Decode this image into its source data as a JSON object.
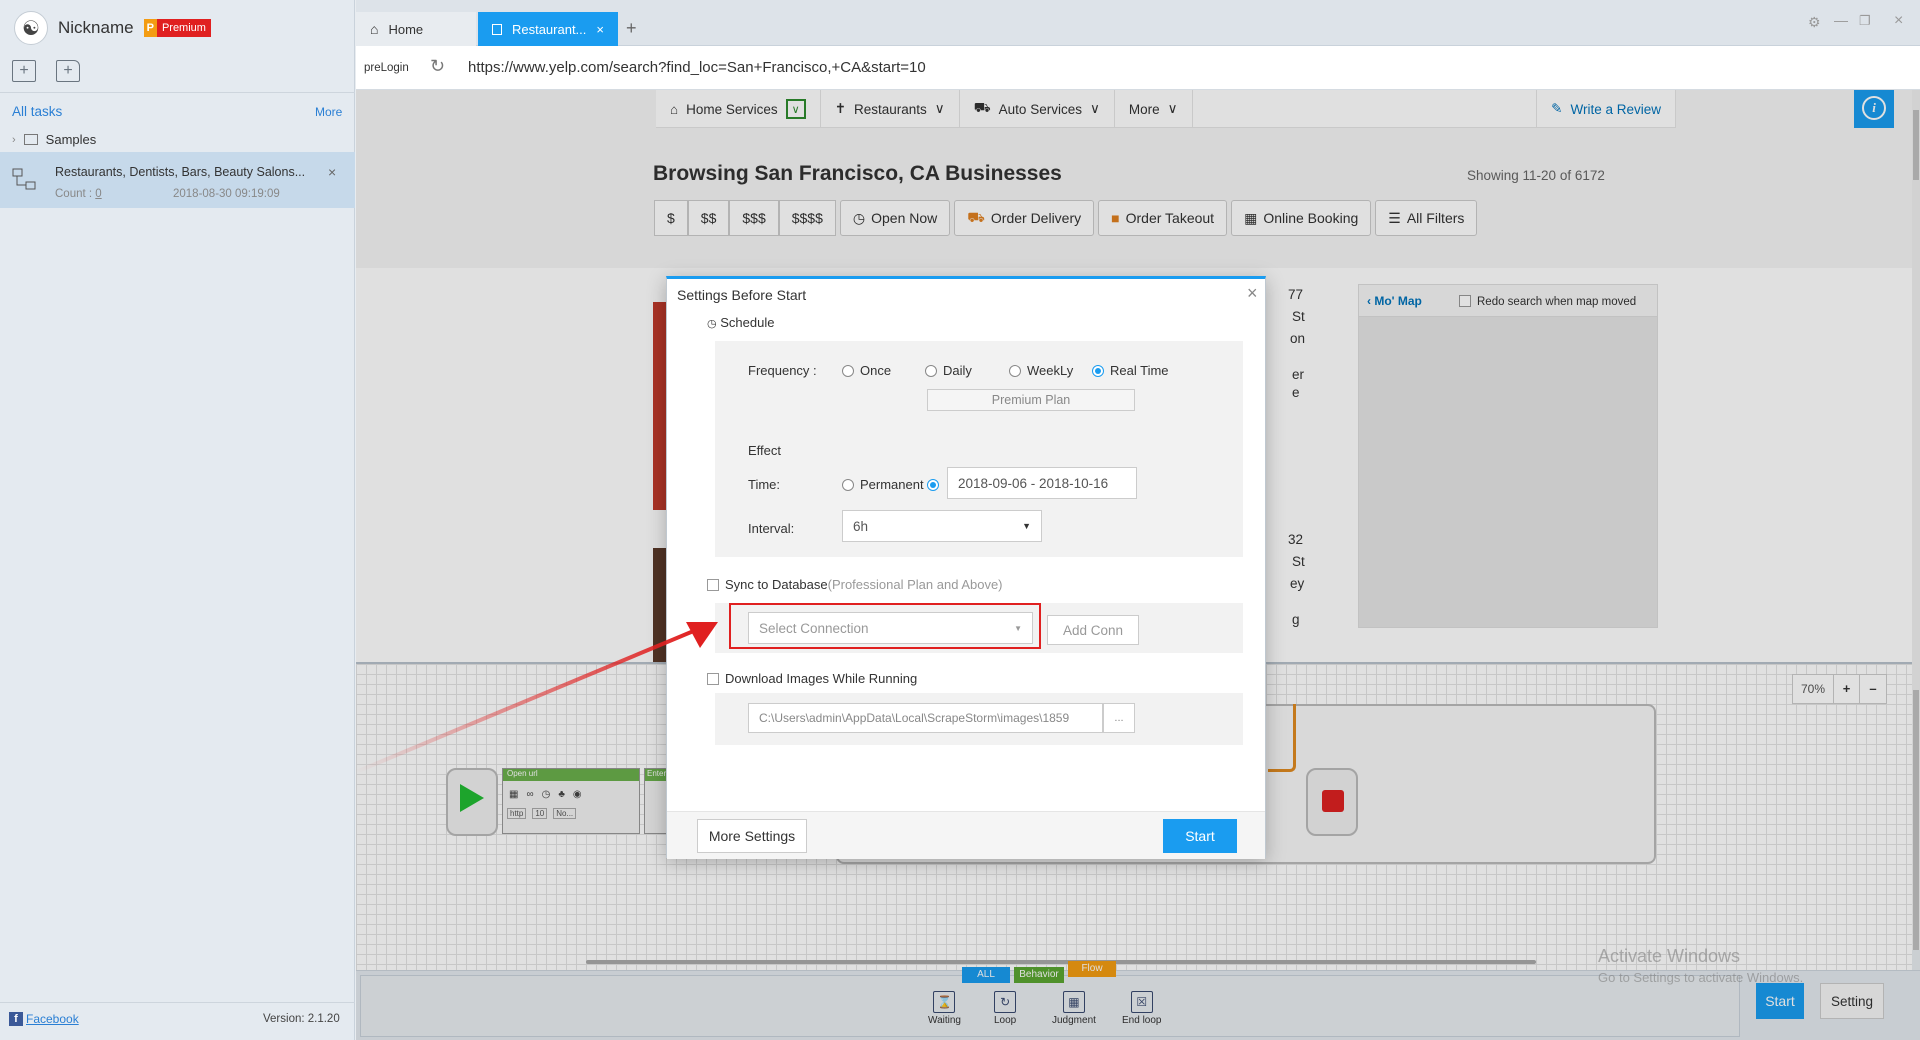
{
  "app": {
    "nickname": "Nickname",
    "plan_letter": "P",
    "plan_label": "Premium",
    "all_tasks": "All tasks",
    "more": "More",
    "samples": "Samples",
    "task": {
      "name": "Restaurants, Dentists, Bars, Beauty Salons...",
      "count_label": "Count :",
      "count": "0",
      "date": "2018-08-30 09:19:09"
    },
    "facebook": "Facebook",
    "version": "Version: 2.1.20"
  },
  "browser": {
    "tabs": [
      {
        "label": "Home"
      },
      {
        "label": "Restaurant..."
      }
    ],
    "prelogin": "preLogin",
    "url": "https://www.yelp.com/search?find_loc=San+Francisco,+CA&start=10"
  },
  "yelp": {
    "nav": [
      "Home Services",
      "Restaurants",
      "Auto Services",
      "More"
    ],
    "write_review": "Write a Review",
    "heading": "Browsing San Francisco, CA Businesses",
    "showing": "Showing 11-20 of 6172",
    "price": [
      "$",
      "$$",
      "$$$",
      "$$$$"
    ],
    "filters": [
      "Open Now",
      "Order Delivery",
      "Order Takeout",
      "Online Booking",
      "All Filters"
    ],
    "map_title": "Mo' Map",
    "redo_search": "Redo search when map moved",
    "partial_right": [
      "77",
      "St",
      "on",
      "er",
      "e",
      "32",
      "St",
      "ey",
      "g"
    ]
  },
  "dialog": {
    "title": "Settings Before Start",
    "schedule": "Schedule",
    "frequency_label": "Frequency :",
    "frequency_options": [
      "Once",
      "Daily",
      "WeekLy",
      "Real Time"
    ],
    "frequency_selected": "Real Time",
    "premium_plan": "Premium Plan",
    "effect": "Effect",
    "time_label": "Time:",
    "permanent": "Permanent",
    "date_range": "2018-09-06 - 2018-10-16",
    "interval_label": "Interval:",
    "interval_value": "6h",
    "sync_label": "Sync to Database",
    "sync_note": "(Professional Plan and Above)",
    "select_connection": "Select Connection",
    "add_conn": "Add Conn",
    "download_images": "Download Images While Running",
    "image_path": "C:\\Users\\admin\\AppData\\Local\\ScrapeStorm\\images\\1859",
    "browse": "...",
    "more_settings": "More Settings",
    "start": "Start"
  },
  "designer": {
    "zoom": "70%",
    "node_open_url": "Open url",
    "node_enter": "Enter",
    "node_fields": [
      "http",
      "10",
      "No..."
    ],
    "tabs": [
      "ALL",
      "Behavior",
      "Flow"
    ],
    "tools": [
      "Waiting",
      "Loop",
      "Judgment",
      "End loop"
    ],
    "start": "Start",
    "setting": "Setting"
  },
  "watermark": {
    "line1": "Activate Windows",
    "line2": "Go to Settings to activate Windows."
  },
  "colors": {
    "accent": "#1a9cf0",
    "highlight": "#e02020",
    "premium": "#e02020"
  }
}
